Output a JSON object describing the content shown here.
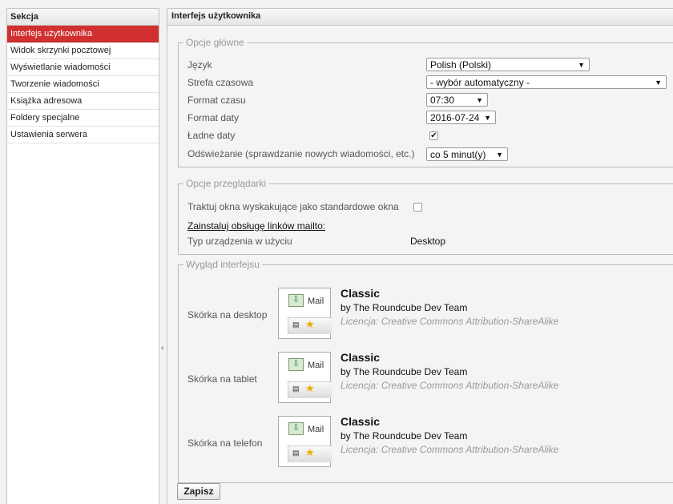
{
  "sections": {
    "header": "Sekcja",
    "items": [
      {
        "label": "Interfejs użytkownika",
        "selected": true
      },
      {
        "label": "Widok skrzynki pocztowej"
      },
      {
        "label": "Wyświetlanie wiadomości"
      },
      {
        "label": "Tworzenie wiadomości"
      },
      {
        "label": "Książka adresowa"
      },
      {
        "label": "Foldery specjalne"
      },
      {
        "label": "Ustawienia serwera"
      }
    ]
  },
  "content": {
    "title": "Interfejs użytkownika",
    "main_options": {
      "legend": "Opcje główne",
      "language_label": "Język",
      "language_value": "Polish (Polski)",
      "timezone_label": "Strefa czasowa",
      "timezone_value": "- wybór automatyczny -",
      "time_format_label": "Format czasu",
      "time_format_value": "07:30",
      "date_format_label": "Format daty",
      "date_format_value": "2016-07-24",
      "pretty_dates_label": "Ładne daty",
      "pretty_dates_checked": true,
      "refresh_label": "Odświeżanie (sprawdzanie nowych wiadomości, etc.)",
      "refresh_value": "co 5 minut(y)"
    },
    "browser_options": {
      "legend": "Opcje przeglądarki",
      "popups_label": "Traktuj okna wyskakujące jako standardowe okna",
      "popups_checked": false,
      "mailto_link": "Zainstaluj obsługę linków mailto:",
      "device_label": "Typ urządzenia w użyciu",
      "device_value": "Desktop"
    },
    "appearance": {
      "legend": "Wygląd interfejsu",
      "thumb_label": "Mail",
      "skins": [
        {
          "label": "Skórka na desktop",
          "name": "Classic",
          "author": "by The Roundcube Dev Team",
          "license": "Licencja: Creative Commons Attribution-ShareAlike"
        },
        {
          "label": "Skórka na tablet",
          "name": "Classic",
          "author": "by The Roundcube Dev Team",
          "license": "Licencja: Creative Commons Attribution-ShareAlike"
        },
        {
          "label": "Skórka na telefon",
          "name": "Classic",
          "author": "by The Roundcube Dev Team",
          "license": "Licencja: Creative Commons Attribution-ShareAlike"
        }
      ]
    },
    "save_label": "Zapisz"
  },
  "colors": {
    "selected_bg": "#d03030",
    "panel_border": "#c4c4c4",
    "background": "#f2f2f2"
  }
}
